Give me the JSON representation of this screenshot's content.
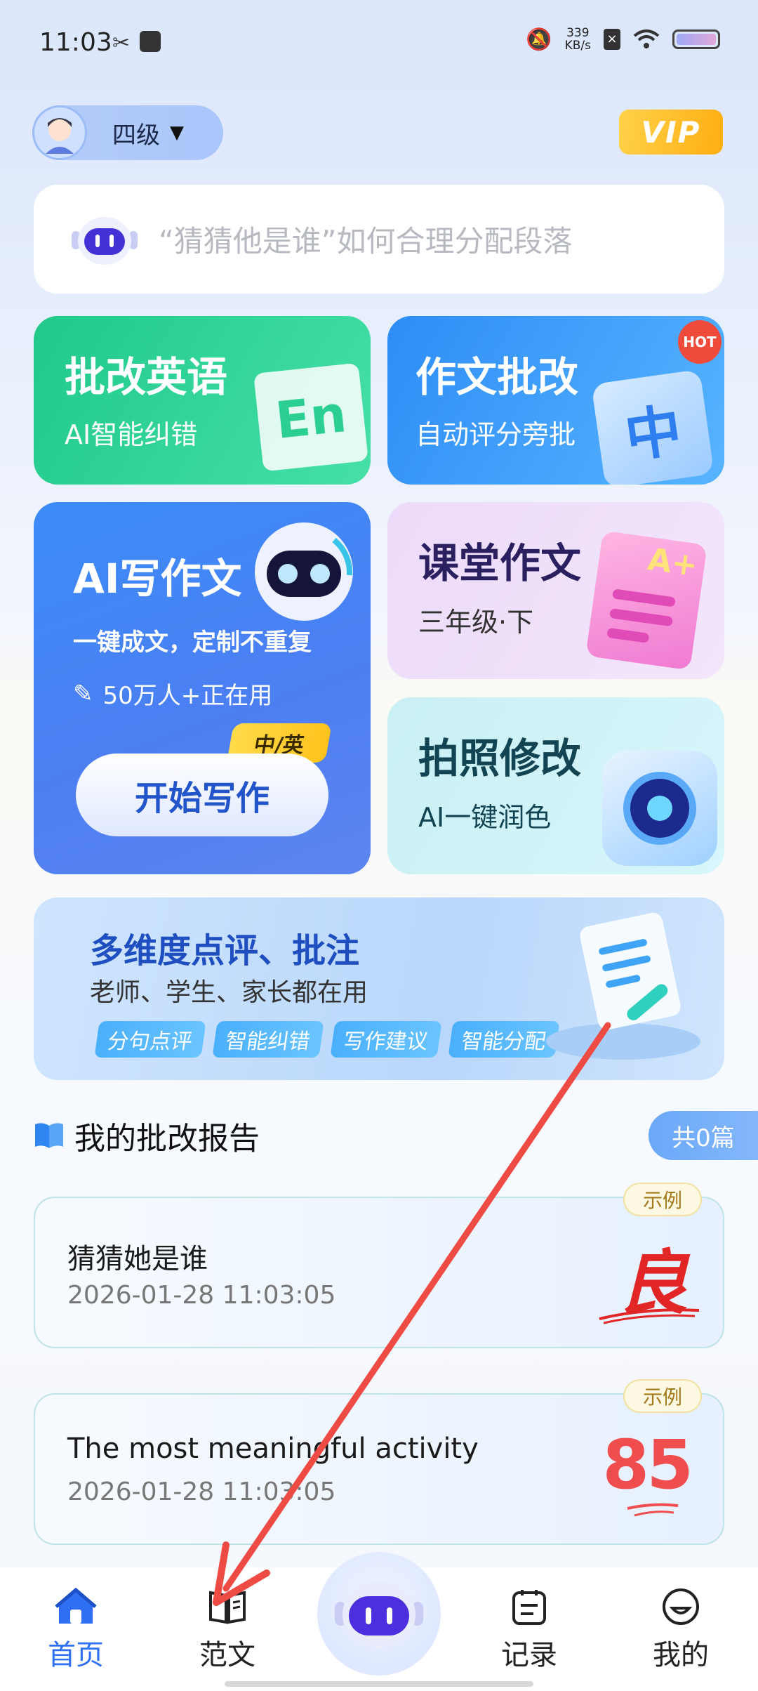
{
  "status_bar": {
    "time": "11:03",
    "speed_value": "339",
    "speed_unit": "KB/s"
  },
  "header": {
    "grade": "四级",
    "vip": "VIP"
  },
  "search": {
    "placeholder": "“猜猜他是谁”如何合理分配段落"
  },
  "cards": {
    "english": {
      "title": "批改英语",
      "subtitle": "AI智能纠错",
      "art": "En"
    },
    "essay": {
      "title": "作文批改",
      "subtitle": "自动评分旁批",
      "hot": "HOT",
      "art": "中"
    },
    "ai_write": {
      "title": "AI写作文",
      "subtitle": "一键成文，定制不重复",
      "users": "50万人+正在用",
      "lang_tag": "中/英",
      "button": "开始写作"
    },
    "classroom": {
      "title": "课堂作文",
      "subtitle": "三年级·下",
      "art": "A+"
    },
    "photo": {
      "title": "拍照修改",
      "subtitle": "AI一键润色"
    }
  },
  "banner": {
    "title": "多维度点评、批注",
    "subtitle": "老师、学生、家长都在用",
    "tags": [
      "分句点评",
      "智能纠错",
      "写作建议",
      "智能分配"
    ]
  },
  "reports": {
    "section_title": "我的批改报告",
    "count": "共0篇",
    "items": [
      {
        "title": "猜猜她是谁",
        "time": "2026-01-28 11:03:05",
        "badge": "示例",
        "mark": "良"
      },
      {
        "title": "The most meaningful activity",
        "time": "2026-01-28 11:03:05",
        "badge": "示例",
        "mark": "85"
      }
    ]
  },
  "nav": {
    "items": [
      {
        "label": "首页"
      },
      {
        "label": "范文"
      },
      {
        "label": "记录"
      },
      {
        "label": "我的"
      }
    ]
  },
  "colors": {
    "accent": "#2f6ff2",
    "arrow": "#ee4b45"
  }
}
